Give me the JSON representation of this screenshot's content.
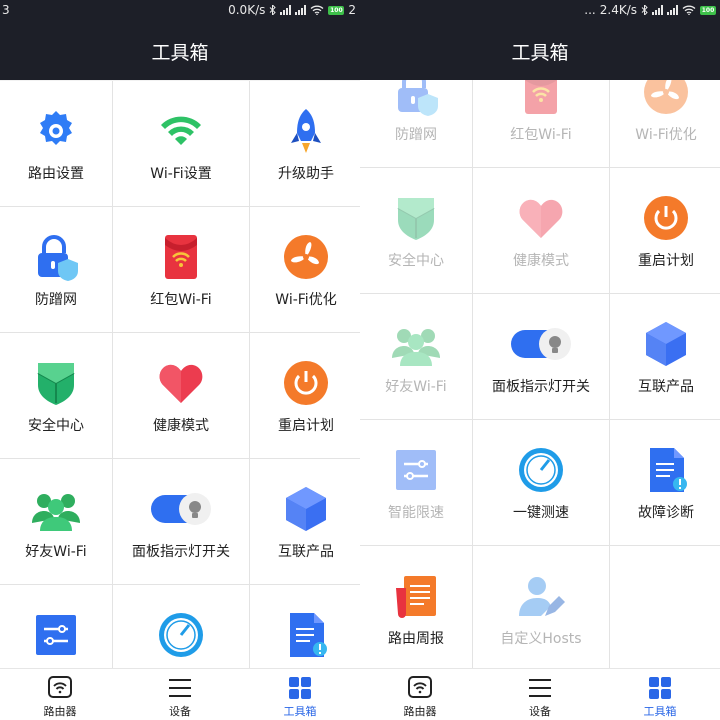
{
  "status_left": {
    "left_text": "3",
    "speed": "0.0K/s",
    "battery": "100",
    "right_text": "2"
  },
  "status_right": {
    "dots": "...",
    "speed": "2.4K/s",
    "battery": "100"
  },
  "header": {
    "title": "工具箱"
  },
  "tools": {
    "router_settings": "路由设置",
    "wifi_settings": "Wi-Fi设置",
    "upgrade_helper": "升级助手",
    "anti_leech": "防蹭网",
    "red_packet_wifi": "红包Wi-Fi",
    "wifi_optimize": "Wi-Fi优化",
    "security_center": "安全中心",
    "health_mode": "健康模式",
    "reboot_plan": "重启计划",
    "friend_wifi": "好友Wi-Fi",
    "panel_light_switch": "面板指示灯开关",
    "iot_products": "互联产品",
    "smart_speed_limit": "智能限速",
    "one_click_speedtest": "一键测速",
    "fault_diagnosis": "故障诊断",
    "router_weekly": "路由周报",
    "custom_hosts": "自定义Hosts"
  },
  "bottom_nav": {
    "router": "路由器",
    "devices": "设备",
    "toolbox": "工具箱"
  },
  "colors": {
    "header_bg": "#1d1f28",
    "active_tab": "#2a67e7",
    "faded_label": "#b5b5b5"
  }
}
